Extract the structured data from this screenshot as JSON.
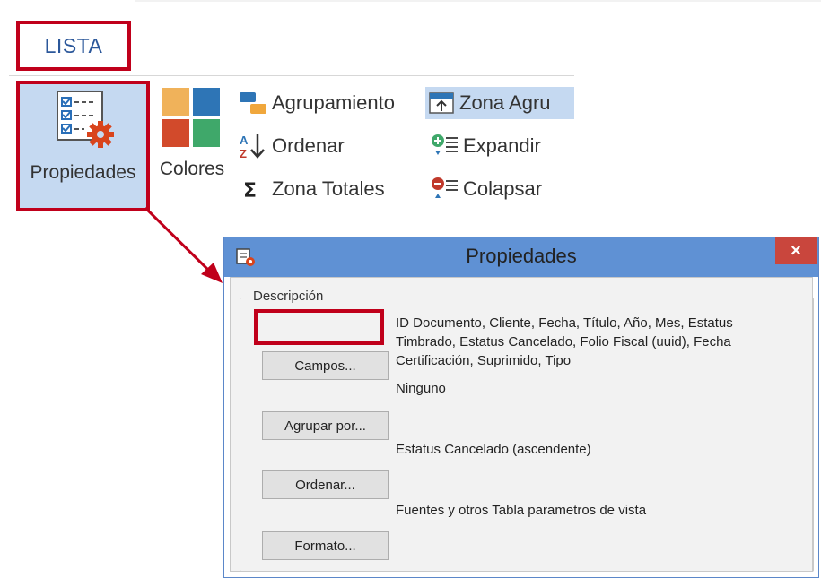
{
  "ribbon": {
    "tab_label": "LISTA",
    "large_buttons": [
      {
        "label": "Propiedades",
        "icon": "properties-checklist-gear-icon"
      },
      {
        "label": "Colores",
        "icon": "color-squares-icon"
      }
    ],
    "small_buttons": [
      {
        "label": "Agrupamiento",
        "icon": "grouping-icon"
      },
      {
        "label": "Ordenar",
        "icon": "sort-az-icon"
      },
      {
        "label": "Zona Totales",
        "icon": "sigma-icon"
      },
      {
        "label": "Zona Agru",
        "icon": "group-zone-icon"
      },
      {
        "label": "Expandir",
        "icon": "expand-plus-icon"
      },
      {
        "label": "Colapsar",
        "icon": "collapse-minus-icon"
      }
    ]
  },
  "dialog": {
    "title": "Propiedades",
    "close_label": "×",
    "group_label": "Descripción",
    "rows": [
      {
        "button": "Campos...",
        "value": "ID Documento, Cliente, Fecha, Título, Año, Mes, Estatus Timbrado, Estatus Cancelado, Folio Fiscal (uuid), Fecha Certificación, Suprimido, Tipo"
      },
      {
        "button": "Agrupar por...",
        "value": "Ninguno"
      },
      {
        "button": "Ordenar...",
        "value": "Estatus Cancelado (ascendente)"
      },
      {
        "button": "Formato...",
        "value": "Fuentes y otros Tabla parametros de vista"
      }
    ]
  },
  "colors": {
    "highlight": "#c0001b",
    "selected": "#c5d9f1",
    "titlebar": "#5f91d4",
    "close": "#c9463d",
    "tab_text": "#2b579a"
  }
}
